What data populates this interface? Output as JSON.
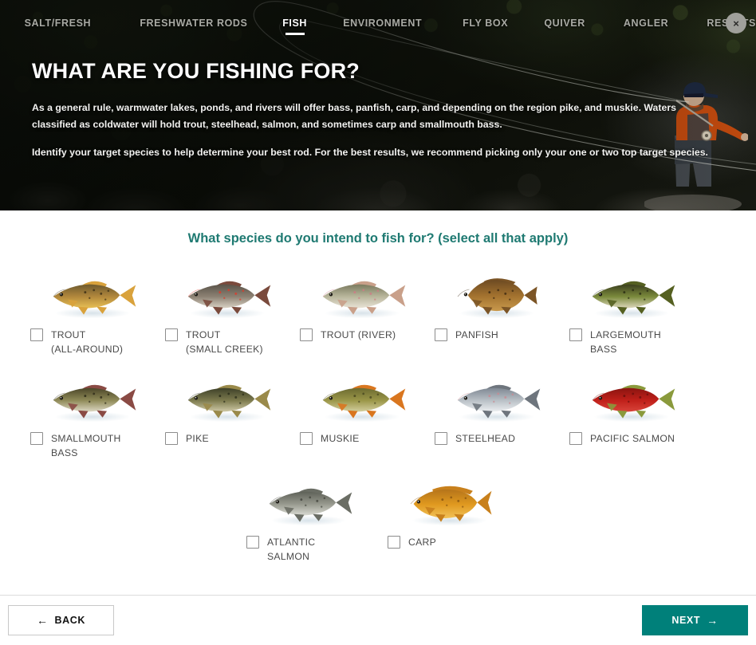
{
  "nav": {
    "items": [
      {
        "label": "SALT/FRESH",
        "active": false
      },
      {
        "label": "FRESHWATER RODS",
        "active": false
      },
      {
        "label": "FISH",
        "active": true
      },
      {
        "label": "ENVIRONMENT",
        "active": false
      },
      {
        "label": "FLY BOX",
        "active": false
      },
      {
        "label": "QUIVER",
        "active": false
      },
      {
        "label": "ANGLER",
        "active": false
      },
      {
        "label": "RESULTS",
        "active": false
      }
    ],
    "close_label": "×"
  },
  "hero": {
    "title": "WHAT ARE YOU FISHING FOR?",
    "paragraph1": "As a general rule, warmwater lakes, ponds, and rivers will offer bass, panfish, carp, and depending on the region pike, and muskie. Waters classified as coldwater will hold trout, steelhead, salmon, and sometimes carp and smallmouth bass.",
    "paragraph2": "Identify your target species to help determine your best rod. For the best results, we recommend picking only your one or two top target species."
  },
  "main": {
    "question": "What species do you intend to fish for? (select all that apply)",
    "rows": [
      [
        {
          "label": "TROUT\n(ALL-AROUND)",
          "checked": false,
          "icon": "trout-all-around-image"
        },
        {
          "label": "TROUT\n(SMALL CREEK)",
          "checked": false,
          "icon": "trout-small-creek-image"
        },
        {
          "label": "TROUT (RIVER)",
          "checked": false,
          "icon": "trout-river-image"
        },
        {
          "label": "PANFISH",
          "checked": false,
          "icon": "panfish-image"
        },
        {
          "label": "LARGEMOUTH\nBASS",
          "checked": false,
          "icon": "largemouth-bass-image"
        }
      ],
      [
        {
          "label": "SMALLMOUTH\nBASS",
          "checked": false,
          "icon": "smallmouth-bass-image"
        },
        {
          "label": "PIKE",
          "checked": false,
          "icon": "pike-image"
        },
        {
          "label": "MUSKIE",
          "checked": false,
          "icon": "muskie-image"
        },
        {
          "label": "STEELHEAD",
          "checked": false,
          "icon": "steelhead-image"
        },
        {
          "label": "PACIFIC SALMON",
          "checked": false,
          "icon": "pacific-salmon-image"
        }
      ],
      [
        {
          "label": "ATLANTIC\nSALMON",
          "checked": false,
          "icon": "atlantic-salmon-image"
        },
        {
          "label": "CARP",
          "checked": false,
          "icon": "carp-image"
        }
      ]
    ]
  },
  "footer": {
    "back_label": "BACK",
    "back_arrow": "←",
    "next_label": "NEXT",
    "next_arrow": "→"
  },
  "colors": {
    "accent_teal": "#00807a",
    "question_teal": "#1f7a72",
    "label_gray": "#4a4a4a",
    "checkbox_border": "#8c8c8c"
  },
  "fish_palettes": {
    "trout-all-around-image": {
      "body_top": "#6d5a2e",
      "body_mid": "#b2883c",
      "belly": "#e8c055",
      "fin": "#d9a23c",
      "spots": "#3d2f16"
    },
    "trout-small-creek-image": {
      "body_top": "#5a5349",
      "body_mid": "#8d8274",
      "belly": "#d9d2c4",
      "fin": "#7a4a3c",
      "spots": "#e03a2a"
    },
    "trout-river-image": {
      "body_top": "#7a7a5e",
      "body_mid": "#b9b79c",
      "belly": "#e9e3d6",
      "fin": "#c9a08a",
      "spots": "#d07a86"
    },
    "panfish-image": {
      "body_top": "#6d4a22",
      "body_mid": "#a4732f",
      "belly": "#c99a4d",
      "fin": "#7c5526",
      "spots": "#3e2a12"
    },
    "largemouth-bass-image": {
      "body_top": "#3b3f1e",
      "body_mid": "#7b8a3c",
      "belly": "#ddd7bc",
      "fin": "#556021",
      "spots": "#2a2e14"
    },
    "smallmouth-bass-image": {
      "body_top": "#4a4528",
      "body_mid": "#8f8a58",
      "belly": "#ddd8c4",
      "fin": "#8a4a44",
      "spots": "#2e2b18"
    },
    "pike-image": {
      "body_top": "#3d4028",
      "body_mid": "#7c7a4e",
      "belly": "#cfc9a6",
      "fin": "#9a8a4a",
      "spots": "#2b2d1a"
    },
    "muskie-image": {
      "body_top": "#6b6a30",
      "body_mid": "#9a9648",
      "belly": "#d4cf9e",
      "fin": "#d9761f",
      "spots": "#4a4820"
    },
    "steelhead-image": {
      "body_top": "#7f8893",
      "body_mid": "#b9c0c6",
      "belly": "#eceff1",
      "fin": "#6e757d",
      "spots": "#c98a92"
    },
    "pacific-salmon-image": {
      "body_top": "#8a1410",
      "body_mid": "#c0201a",
      "belly": "#d8443a",
      "fin": "#8a9a3c",
      "spots": "#6a0f0c"
    },
    "atlantic-salmon-image": {
      "body_top": "#5e6158",
      "body_mid": "#97998e",
      "belly": "#d9dad2",
      "fin": "#6a6d64",
      "spots": "#45473f"
    },
    "carp-image": {
      "body_top": "#b5741a",
      "body_mid": "#e0991f",
      "belly": "#f2c35a",
      "fin": "#c8801c",
      "spots": "#8a5610"
    }
  }
}
